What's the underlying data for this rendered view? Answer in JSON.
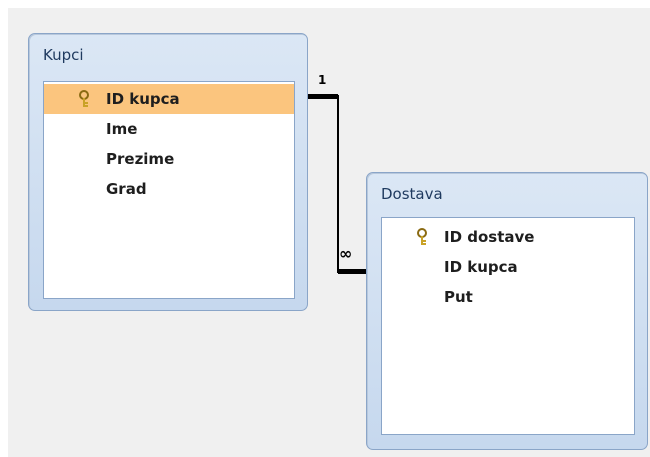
{
  "tables": [
    {
      "title": "Kupci",
      "fields": [
        {
          "label": "ID kupca",
          "key": true,
          "selected": true
        },
        {
          "label": "Ime",
          "key": false,
          "selected": false
        },
        {
          "label": "Prezime",
          "key": false,
          "selected": false
        },
        {
          "label": "Grad",
          "key": false,
          "selected": false
        }
      ]
    },
    {
      "title": "Dostava",
      "fields": [
        {
          "label": "ID dostave",
          "key": true,
          "selected": false
        },
        {
          "label": "ID kupca",
          "key": false,
          "selected": false
        },
        {
          "label": "Put",
          "key": false,
          "selected": false
        }
      ]
    }
  ],
  "relationship": {
    "one_label": "1",
    "many_label": "∞"
  },
  "colors": {
    "selected_row": "#fbc57e",
    "table_border": "#8aa5c8",
    "title_text": "#1f3a5f",
    "workspace": "#f0f0f0"
  },
  "icons": {
    "primary_key": "key-icon"
  }
}
